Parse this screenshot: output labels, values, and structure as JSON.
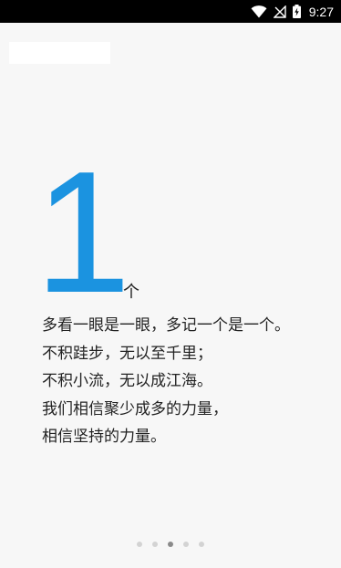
{
  "status_bar": {
    "time": "9:27",
    "icons": [
      "wifi-icon",
      "cellular-no-signal-icon",
      "battery-charging-icon"
    ]
  },
  "guide": {
    "number": "1",
    "unit": "个",
    "lines": [
      "多看一眼是一眼，多记一个是一个。",
      "不积跬步，无以至千里；",
      "不积小流，无以成江海。",
      "我们相信聚少成多的力量，",
      "相信坚持的力量。"
    ]
  },
  "pager": {
    "count": 5,
    "active_index": 2
  },
  "colors": {
    "accent": "#1b93e0",
    "text": "#222222",
    "background": "#f7f7f7",
    "dot_inactive": "#d3d3d3",
    "dot_active": "#8a8a8a"
  }
}
